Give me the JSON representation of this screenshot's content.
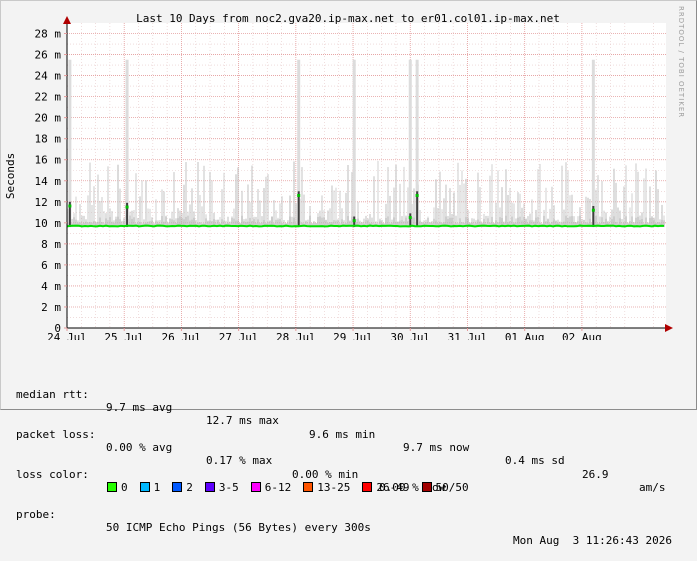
{
  "chart_data": {
    "type": "line",
    "title": "Last 10 Days from noc2.gva20.ip-max.net to er01.col01.ip-max.net",
    "ylabel": "Seconds",
    "ylim": [
      0,
      0.029
    ],
    "y_ticks": [
      {
        "v": 0,
        "label": "0"
      },
      {
        "v": 0.002,
        "label": "2 m"
      },
      {
        "v": 0.004,
        "label": "4 m"
      },
      {
        "v": 0.006,
        "label": "6 m"
      },
      {
        "v": 0.008,
        "label": "8 m"
      },
      {
        "v": 0.01,
        "label": "10 m"
      },
      {
        "v": 0.012,
        "label": "12 m"
      },
      {
        "v": 0.014,
        "label": "14 m"
      },
      {
        "v": 0.016,
        "label": "16 m"
      },
      {
        "v": 0.018,
        "label": "18 m"
      },
      {
        "v": 0.02,
        "label": "20 m"
      },
      {
        "v": 0.022,
        "label": "22 m"
      },
      {
        "v": 0.024,
        "label": "24 m"
      },
      {
        "v": 0.026,
        "label": "26 m"
      },
      {
        "v": 0.028,
        "label": "28 m"
      }
    ],
    "x_range_days": [
      0,
      10.47
    ],
    "x_ticks": [
      {
        "d": 0.0,
        "label": "24 Jul"
      },
      {
        "d": 1.0,
        "label": "25 Jul"
      },
      {
        "d": 2.0,
        "label": "26 Jul"
      },
      {
        "d": 3.0,
        "label": "27 Jul"
      },
      {
        "d": 4.0,
        "label": "28 Jul"
      },
      {
        "d": 5.0,
        "label": "29 Jul"
      },
      {
        "d": 6.0,
        "label": "30 Jul"
      },
      {
        "d": 7.0,
        "label": "31 Jul"
      },
      {
        "d": 8.0,
        "label": "01 Aug"
      },
      {
        "d": 9.0,
        "label": "02 Aug"
      }
    ],
    "median_rtt_ms": 9.7,
    "spikes": [
      {
        "d": 0.05,
        "ms": 11.6
      },
      {
        "d": 1.05,
        "ms": 11.5
      },
      {
        "d": 4.05,
        "ms": 12.6
      },
      {
        "d": 5.02,
        "ms": 10.2
      },
      {
        "d": 6.0,
        "ms": 10.5
      },
      {
        "d": 6.12,
        "ms": 12.6
      },
      {
        "d": 9.2,
        "ms": 11.2
      }
    ],
    "grid": true,
    "colors": {
      "median": "#00e000",
      "smoke": "#c8c8c8",
      "grid_minor": "#e6c8c8",
      "grid_major": "#e49a9a",
      "axis": "#000000",
      "arrow": "#b00000"
    }
  },
  "info": {
    "median_rtt": {
      "label": "median rtt:",
      "avg": "9.7 ms avg",
      "max": "12.7 ms max",
      "min": "9.6 ms min",
      "now": "9.7 ms now",
      "sd": "0.4 ms sd",
      "ams_value": "26.9",
      "ams_unit": "am/s"
    },
    "packet_loss": {
      "label": "packet loss:",
      "avg": "0.00 % avg",
      "max": "0.17 % max",
      "min": "0.00 % min",
      "now": "0.00 % now"
    },
    "loss_color": {
      "label": "loss color:",
      "items": [
        {
          "label": "0",
          "color": "#26ff00"
        },
        {
          "label": "1",
          "color": "#00b8ff"
        },
        {
          "label": "2",
          "color": "#0059ff"
        },
        {
          "label": "3-5",
          "color": "#5e00ff"
        },
        {
          "label": "6-12",
          "color": "#ff00ff"
        },
        {
          "label": "13-25",
          "color": "#ff5500"
        },
        {
          "label": "26-49",
          "color": "#ff0000"
        },
        {
          "label": "50/50",
          "color": "#a10000"
        }
      ]
    },
    "probe": {
      "label": "probe:",
      "text": "50 ICMP Echo Pings (56 Bytes) every 300s",
      "timestamp": "Mon Aug  3 11:26:43 2026"
    }
  },
  "watermark": "RRDTOOL / TOBI OETIKER"
}
